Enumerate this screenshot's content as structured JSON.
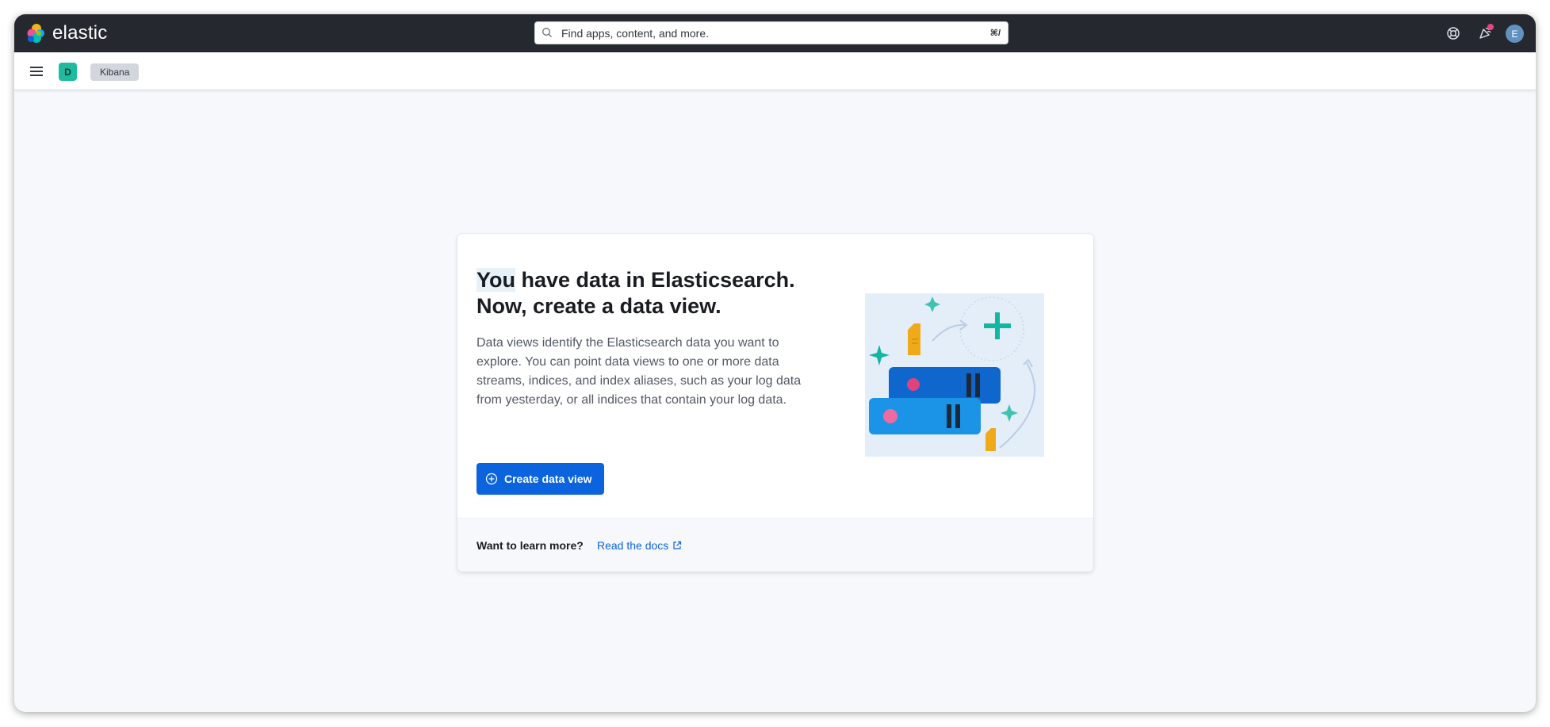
{
  "header": {
    "logo_text": "elastic",
    "search_placeholder": "Find apps, content, and more.",
    "search_shortcut": "⌘/",
    "avatar_initial": "E"
  },
  "subheader": {
    "space_initial": "D",
    "breadcrumb": "Kibana"
  },
  "card": {
    "title_highlight": "You",
    "title_rest": " have data in Elasticsearch. Now, create a data view.",
    "description": "Data views identify the Elasticsearch data you want to explore. You can point data views to one or more data streams, indices, and index aliases, such as your log data from yesterday, or all indices that contain your log data.",
    "create_button": "Create data view",
    "footer_prompt": "Want to learn more?",
    "footer_link": "Read the docs"
  },
  "colors": {
    "topbar": "#25282f",
    "primary": "#0b64dd",
    "space_badge": "#1ebb9f",
    "notification": "#e7467e"
  },
  "icons": [
    "elastic-logo",
    "search-icon",
    "help-icon",
    "news-feed-icon",
    "menu-icon",
    "plus-in-circle-icon",
    "external-link-icon"
  ]
}
